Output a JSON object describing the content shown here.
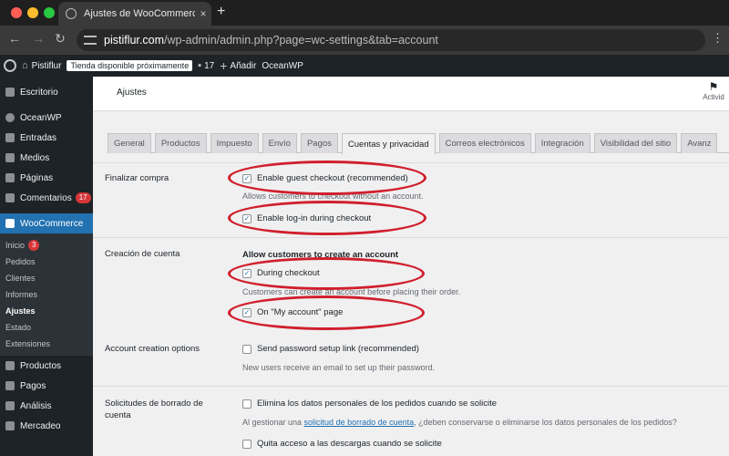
{
  "browser": {
    "tab_title": "Ajustes de WooCommerce ‹ P",
    "tab_close": "×",
    "new_tab": "+",
    "url_host": "pistiflur.com",
    "url_path": "/wp-admin/admin.php?page=wc-settings&tab=account"
  },
  "adminbar": {
    "site_name": "Pistiflur",
    "store_badge": "Tienda disponible próximamente",
    "comments_count": "17",
    "add_new": "Añadir",
    "theme": "OceanWP"
  },
  "sidebar": {
    "items": [
      {
        "label": "Escritorio"
      },
      {
        "label": "OceanWP"
      },
      {
        "label": "Entradas"
      },
      {
        "label": "Medios"
      },
      {
        "label": "Páginas"
      },
      {
        "label": "Comentarios",
        "count": "17"
      },
      {
        "label": "WooCommerce"
      }
    ],
    "submenu": [
      {
        "label": "Inicio",
        "count": "3"
      },
      {
        "label": "Pedidos"
      },
      {
        "label": "Clientes"
      },
      {
        "label": "Informes"
      },
      {
        "label": "Ajustes"
      },
      {
        "label": "Estado"
      },
      {
        "label": "Extensiones"
      }
    ],
    "after": [
      {
        "label": "Productos"
      },
      {
        "label": "Pagos"
      },
      {
        "label": "Análisis"
      },
      {
        "label": "Mercadeo"
      }
    ]
  },
  "header": {
    "title": "Ajustes",
    "activity": "Activid"
  },
  "tabs": [
    "General",
    "Productos",
    "Impuesto",
    "Envío",
    "Pagos",
    "Cuentas y privacidad",
    "Correos electrónicos",
    "Integración",
    "Visibilidad del sitio",
    "Avanz"
  ],
  "settings": {
    "checkout": {
      "label": "Finalizar compra",
      "guest": "Enable guest checkout (recommended)",
      "guest_desc": "Allows customers to checkout without an account.",
      "login": "Enable log-in during checkout"
    },
    "account": {
      "label": "Creación de cuenta",
      "heading": "Allow customers to create an account",
      "during": "During checkout",
      "during_desc": "Customers can create an account before placing their order.",
      "myaccount": "On \"My account\" page"
    },
    "options": {
      "label": "Account creation options",
      "send_link": "Send password setup link (recommended)",
      "send_desc": "New users receive an email to set up their password."
    },
    "erasure": {
      "label": "Solicitudes de borrado de cuenta",
      "remove": "Elimina los datos personales de los pedidos cuando se solicite",
      "desc_pre": "Al gestionar una ",
      "desc_link": "solicitud de borrado de cuenta",
      "desc_post": ", ¿deben conservarse o eliminarse los datos personales de los pedidos?",
      "downloads": "Quita acceso a las descargas cuando se solicite"
    }
  },
  "colors": {
    "accent": "#2271b1",
    "annotation": "#d01f2c",
    "admin_dark": "#1d2327"
  }
}
